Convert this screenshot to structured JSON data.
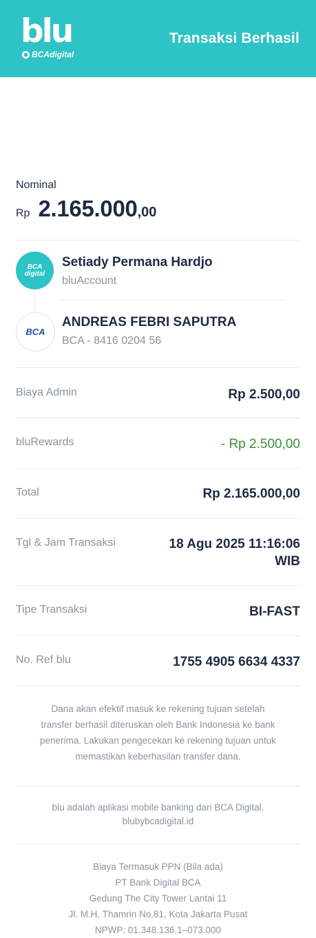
{
  "header": {
    "logo_text": "blu",
    "logo_sub": "BCAdigital",
    "title": "Transaksi Berhasil"
  },
  "nominal": {
    "label": "Nominal",
    "currency": "Rp",
    "amount": "2.165.000",
    "decimal": ",00"
  },
  "sender": {
    "icon_text_1": "BCA",
    "icon_text_2": "digital",
    "name": "Setiady Permana Hardjo",
    "account": "bluAccount"
  },
  "recipient": {
    "icon_text": "BCA",
    "name": "ANDREAS FEBRI SAPUTRA",
    "account": "BCA - 8416 0204 56"
  },
  "details": [
    {
      "label": "Biaya Admin",
      "value": "Rp 2.500,00"
    },
    {
      "label": "bluRewards",
      "value": "- Rp 2.500,00"
    },
    {
      "label": "Total",
      "value": "Rp 2.165.000,00"
    },
    {
      "label": "Tgl & Jam Transaksi",
      "value_1": "18 Agu 2025 11:16:06",
      "value_2": "WIB"
    },
    {
      "label": "Tipe Transaksi",
      "value": "BI-FAST"
    },
    {
      "label": "No. Ref blu",
      "value": "1755 4905 6634 4337"
    }
  ],
  "notice": {
    "line_1": "Dana akan efektif masuk ke rekening tujuan setelah",
    "line_2": "transfer berhasil diteruskan oleh Bank Indonesia ke bank",
    "line_3": "penerima. Lakukan pengecekan ke rekening tujuan untuk",
    "line_4": "memastikan keberhasilan transfer dana."
  },
  "about": {
    "line_1": "blu adalah aplikasi mobile banking dari BCA Digital.",
    "line_2": "blubybcadigital.id"
  },
  "footer": {
    "line_1": "Biaya Termasuk PPN (Bila ada)",
    "line_2": "PT Bank Digital BCA",
    "line_3": "Gedung The City Tower Lantai 11",
    "line_4": "Jl. M.H. Thamrin No.81, Kota Jakarta Pusat",
    "line_5": "NPWP: 01.348.136.1–073.000"
  },
  "colors": {
    "brand": "#2ec3c6",
    "text_primary": "#1f2a44",
    "text_secondary": "#8a93a0",
    "rewards_green": "#3a8f3a"
  }
}
